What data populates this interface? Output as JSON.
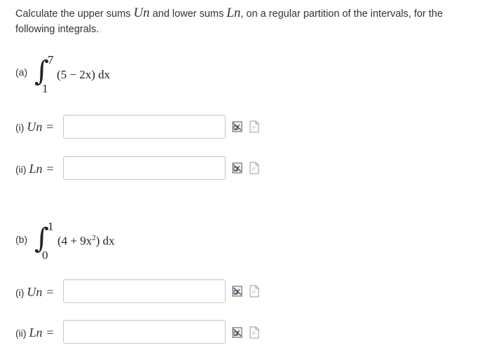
{
  "intro": {
    "prefix": "Calculate the upper sums ",
    "var_upper": "Un",
    "middle": " and lower sums ",
    "var_lower": "Ln",
    "suffix": ", on a regular partition of the intervals, for the following integrals."
  },
  "parts": [
    {
      "label": "(a)",
      "upper_limit": "7",
      "lower_limit": "1",
      "integrand": "(5 − 2x) dx",
      "rows": [
        {
          "prefix": "(i) ",
          "var": "Un",
          "eq": "=",
          "value": ""
        },
        {
          "prefix": "(ii) ",
          "var": "Ln",
          "eq": "=",
          "value": ""
        }
      ]
    },
    {
      "label": "(b)",
      "upper_limit": "1",
      "lower_limit": "0",
      "integrand_open": "(4 + 9x",
      "integrand_exp": "2",
      "integrand_close": ") dx",
      "rows": [
        {
          "prefix": "(i) ",
          "var": "Un",
          "eq": "=",
          "value": ""
        },
        {
          "prefix": "(ii) ",
          "var": "Ln",
          "eq": "=",
          "value": ""
        }
      ]
    }
  ],
  "icons": {
    "first": "drawing-tool-icon",
    "second": "file-upload-icon"
  }
}
